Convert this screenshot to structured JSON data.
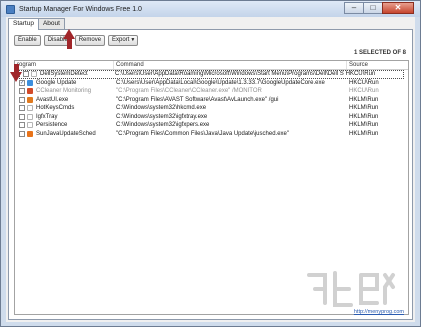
{
  "window": {
    "title": "Startup Manager For Windows Free 1.0"
  },
  "tabs": [
    {
      "label": "Startup"
    },
    {
      "label": "About"
    }
  ],
  "toolbar": {
    "enable_label": "Enable",
    "disable_label": "Disable",
    "remove_label": "Remove",
    "export_label": "Export"
  },
  "status": {
    "selected_count": "1 SELECTED OF 8"
  },
  "table": {
    "headers": {
      "program": "rogram",
      "command": "Command",
      "source": "Source"
    },
    "rows": [
      {
        "checked": false,
        "program": "DellSystemDetect",
        "command": "C:\\Users\\User\\AppData\\Roaming\\Microsoft\\Windows\\Start Menu\\Programs\\Dell\\Dell Sys...",
        "source": "HKCU\\Run",
        "icon_color": "#ffffff"
      },
      {
        "checked": true,
        "program": "Google Update",
        "command": "C:\\Users\\User\\AppData\\Local\\Google\\Update\\1.3.33.7\\GoogleUpdateCore.exe",
        "source": "HKCU\\Run",
        "icon_color": "#3c8fde"
      },
      {
        "checked": false,
        "program": "CCleaner Monitoring",
        "command": "\"C:\\Program Files\\CCleaner\\CCleaner.exe\" /MONITOR",
        "source": "HKCU\\Run",
        "icon_color": "#d24a2a"
      },
      {
        "checked": false,
        "program": "AvastUI.exe",
        "command": "\"C:\\Program Files\\AVAST Software\\Avast\\AvLaunch.exe\" /gui",
        "source": "HKLM\\Run",
        "icon_color": "#e07a1f"
      },
      {
        "checked": false,
        "program": "HotKeysCmds",
        "command": "C:\\Windows\\system32\\hkcmd.exe",
        "source": "HKLM\\Run",
        "icon_color": "#ffffff"
      },
      {
        "checked": false,
        "program": "IgfxTray",
        "command": "C:\\Windows\\system32\\igfxtray.exe",
        "source": "HKLM\\Run",
        "icon_color": "#ffffff"
      },
      {
        "checked": false,
        "program": "Persistence",
        "command": "C:\\Windows\\system32\\igfxpers.exe",
        "source": "HKLM\\Run",
        "icon_color": "#ffffff"
      },
      {
        "checked": false,
        "program": "SunJavaUpdateSched",
        "command": "\"C:\\Program Files\\Common Files\\Java\\Java Update\\jusched.exe\"",
        "source": "HKLM\\Run",
        "icon_color": "#e8731a"
      }
    ]
  },
  "footer": {
    "link": "http://menyprog.com"
  },
  "colors": {
    "annotation_arrow": "#a0262a"
  }
}
